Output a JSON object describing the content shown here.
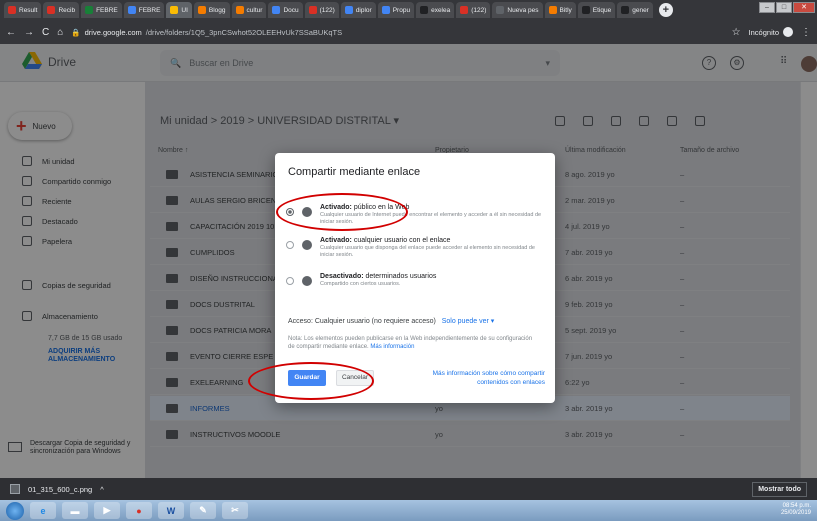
{
  "browser": {
    "tabs": [
      {
        "label": "Result",
        "color": "#d93025"
      },
      {
        "label": "Recib",
        "color": "#d93025"
      },
      {
        "label": "FEBRE",
        "color": "#188038"
      },
      {
        "label": "FEBRE",
        "color": "#4285f4"
      },
      {
        "label": "UI",
        "color": "#fbbc04",
        "active": true
      },
      {
        "label": "Blogg",
        "color": "#f57c00"
      },
      {
        "label": "cultur",
        "color": "#f57c00"
      },
      {
        "label": "Docu",
        "color": "#4285f4"
      },
      {
        "label": "(122)",
        "color": "#d93025"
      },
      {
        "label": "diplor",
        "color": "#4285f4"
      },
      {
        "label": "Propu",
        "color": "#4285f4"
      },
      {
        "label": "exelea",
        "color": "#202124"
      },
      {
        "label": "(122)",
        "color": "#d93025"
      },
      {
        "label": "Nueva pes",
        "color": "#5f6368"
      },
      {
        "label": "Bitly",
        "color": "#f57c00"
      },
      {
        "label": "Etique",
        "color": "#202124"
      },
      {
        "label": "gener",
        "color": "#202124"
      }
    ],
    "url_host": "drive.google.com",
    "url_path": "/drive/folders/1Q5_3pnCSwhot52OLEEHvUk7SSaBUKqTS",
    "mode_label": "Incógnito"
  },
  "drive": {
    "brand": "Drive",
    "search_placeholder": "Buscar en Drive",
    "new_label": "Nuevo",
    "sidebar": [
      {
        "label": "Mi unidad",
        "icon": "my-drive-icon"
      },
      {
        "label": "Compartido conmigo",
        "icon": "shared-icon"
      },
      {
        "label": "Reciente",
        "icon": "clock-icon"
      },
      {
        "label": "Destacado",
        "icon": "star-icon"
      },
      {
        "label": "Papelera",
        "icon": "trash-icon"
      },
      {
        "label": "Copias de seguridad",
        "icon": "backup-icon"
      },
      {
        "label": "Almacenamiento",
        "icon": "storage-icon"
      }
    ],
    "storage_text": "7,7 GB de 15 GB usado",
    "storage_link": "ADQUIRIR MÁS ALMACENAMIENTO",
    "download_text": "Descargar Copia de seguridad y sincronización para Windows",
    "breadcrumb": "Mi unidad  >  2019  >  UNIVERSIDAD DISTRITAL  ▾",
    "columns": {
      "name": "Nombre  ↑",
      "owner": "Propietario",
      "modified": "Última modificación",
      "size": "Tamaño de archivo"
    },
    "rows": [
      {
        "name": "ASISTENCIA SEMINARIO",
        "owner": "",
        "modified": "8 ago. 2019 yo",
        "size": "–"
      },
      {
        "name": "AULAS SERGIO BRICENO",
        "owner": "",
        "modified": "2 mar. 2019 yo",
        "size": "–"
      },
      {
        "name": "CAPACITACIÓN 2019 10",
        "owner": "",
        "modified": "4 jul. 2019 yo",
        "size": "–"
      },
      {
        "name": "CUMPLIDOS",
        "owner": "",
        "modified": "7 abr. 2019 yo",
        "size": "–"
      },
      {
        "name": "DISEÑO INSTRUCCIONAL",
        "owner": "",
        "modified": "6 abr. 2019 yo",
        "size": "–"
      },
      {
        "name": "DOCS DUSTRITAL",
        "owner": "",
        "modified": "9 feb. 2019 yo",
        "size": "–"
      },
      {
        "name": "DOCS PATRICIA MORA",
        "owner": "",
        "modified": "5 sept. 2019 yo",
        "size": "–"
      },
      {
        "name": "EVENTO CIERRE ESPE",
        "owner": "",
        "modified": "7 jun. 2019 yo",
        "size": "–"
      },
      {
        "name": "EXELEARNING",
        "owner": "",
        "modified": "6:22 yo",
        "size": "–"
      },
      {
        "name": "INFORMES",
        "owner": "yo",
        "modified": "3 abr. 2019 yo",
        "size": "–",
        "selected": true
      },
      {
        "name": "INSTRUCTIVOS MOODLE",
        "owner": "yo",
        "modified": "3 abr. 2019 yo",
        "size": "–"
      }
    ]
  },
  "dialog": {
    "title": "Compartir mediante enlace",
    "options": [
      {
        "title_bold": "Activado:",
        "title_rest": " público en la Web",
        "desc": "Cualquier usuario de Internet puede encontrar el elemento y acceder a él sin necesidad de iniciar sesión.",
        "selected": true
      },
      {
        "title_bold": "Activado:",
        "title_rest": " cualquier usuario con el enlace",
        "desc": "Cualquier usuario que disponga del enlace puede acceder al elemento sin necesidad de iniciar sesión.",
        "selected": false
      },
      {
        "title_bold": "Desactivado:",
        "title_rest": " determinados usuarios",
        "desc": "Compartido con ciertos usuarios.",
        "selected": false
      }
    ],
    "access_label": "Acceso:  Cualquier usuario (no requiere acceso)",
    "access_link": "Solo puede ver  ▾",
    "note": "Nota: Los elementos pueden publicarse en la Web independientemente de su configuración de compartir mediante enlace.",
    "note_link": "Más información",
    "save": "Guardar",
    "cancel": "Cancelar",
    "more_link": "Más información sobre cómo compartir contenidos con enlaces"
  },
  "downloads": {
    "file": "01_315_600_c.png",
    "show_all": "Mostrar todo"
  },
  "taskbar": {
    "time": "08:54 p.m.",
    "date": "25/09/2019"
  }
}
